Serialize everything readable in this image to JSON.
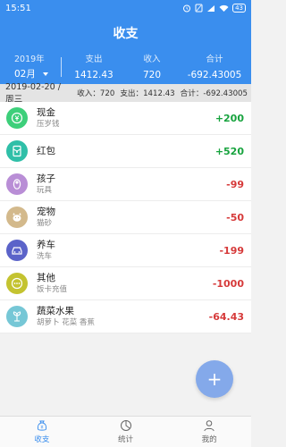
{
  "status": {
    "time": "15:51",
    "battery": "43"
  },
  "header": {
    "title": "收支"
  },
  "summary": {
    "year": "2019年",
    "month": "02月",
    "expense_label": "支出",
    "expense_value": "1412.43",
    "income_label": "收入",
    "income_value": "720",
    "total_label": "合计",
    "total_value": "-692.43005"
  },
  "datebar": {
    "date": "2019-02-20 / 周三",
    "income": "收入：720",
    "expense": "支出：1412.43",
    "total": "合计：-692.43005"
  },
  "items": [
    {
      "name": "现金",
      "note": "压岁钱",
      "amount": "+200",
      "icon": "cash-icon",
      "color": "#3dcf7a"
    },
    {
      "name": "红包",
      "note": "",
      "amount": "+520",
      "icon": "red-packet-icon",
      "color": "#2fbfa8"
    },
    {
      "name": "孩子",
      "note": "玩具",
      "amount": "-99",
      "icon": "baby-icon",
      "color": "#b98ed6"
    },
    {
      "name": "宠物",
      "note": "猫砂",
      "amount": "-50",
      "icon": "pet-icon",
      "color": "#d3b98c"
    },
    {
      "name": "养车",
      "note": "洗车",
      "amount": "-199",
      "icon": "car-icon",
      "color": "#5b63c9"
    },
    {
      "name": "其他",
      "note": "饭卡充值",
      "amount": "-1000",
      "icon": "more-icon",
      "color": "#c4c330"
    },
    {
      "name": "蔬菜水果",
      "note": "胡萝卜 花菜 香蕉",
      "amount": "-64.43",
      "icon": "vegetable-icon",
      "color": "#76c7d6"
    }
  ],
  "fab": {
    "label": "+"
  },
  "nav": {
    "items": [
      {
        "label": "收支",
        "icon": "money-bag-icon"
      },
      {
        "label": "统计",
        "icon": "pie-chart-icon"
      },
      {
        "label": "我的",
        "icon": "user-icon"
      }
    ]
  }
}
